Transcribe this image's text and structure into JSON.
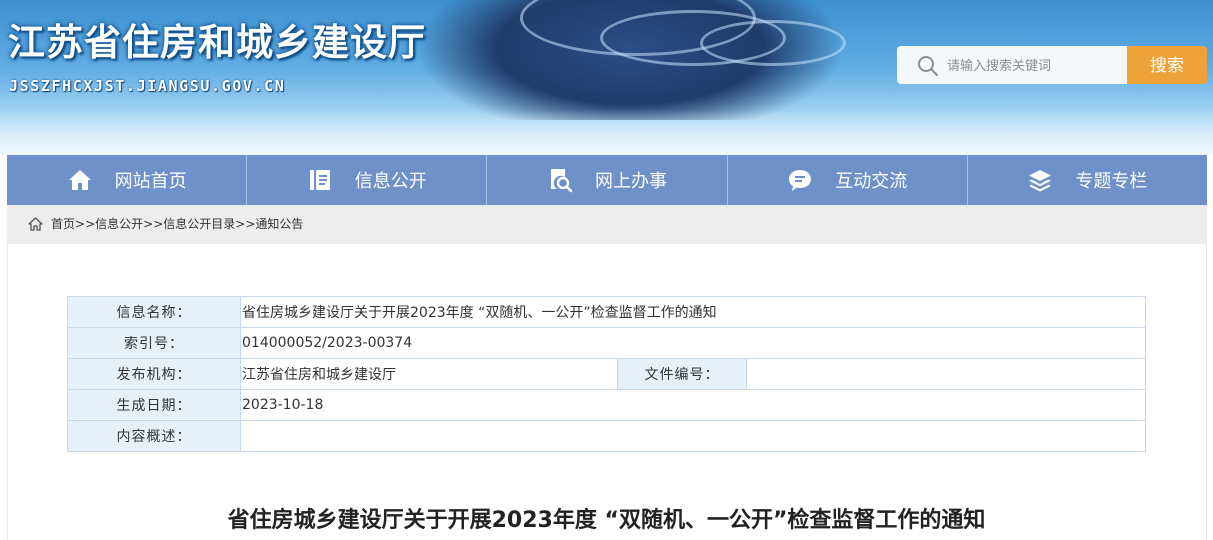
{
  "header": {
    "site_title": "江苏省住房和城乡建设厅",
    "site_domain": "JSSZFHCXJST.JIANGSU.GOV.CN",
    "search_placeholder": "请输入搜索关键词",
    "search_button": "搜索",
    "accent_color": "#f0a23a"
  },
  "nav": {
    "background": "#6e91c9",
    "items": [
      {
        "label": "网站首页",
        "icon": "home-icon"
      },
      {
        "label": "信息公开",
        "icon": "document-icon"
      },
      {
        "label": "网上办事",
        "icon": "search-document-icon"
      },
      {
        "label": "互动交流",
        "icon": "chat-icon"
      },
      {
        "label": "专题专栏",
        "icon": "layers-icon"
      }
    ]
  },
  "breadcrumb": {
    "items": [
      "首页",
      "信息公开",
      "信息公开目录",
      "通知公告"
    ],
    "separator": ">>"
  },
  "info": {
    "name_label": "信息名称：",
    "name_value": "省住房城乡建设厅关于开展2023年度 “双随机、一公开”检查监督工作的通知",
    "index_label": "索引号：",
    "index_value": "014000052/2023-00374",
    "org_label": "发布机构：",
    "org_value": "江苏省住房和城乡建设厅",
    "docno_label": "文件编号：",
    "docno_value": "",
    "date_label": "生成日期：",
    "date_value": "2023-10-18",
    "summary_label": "内容概述：",
    "summary_value": ""
  },
  "article": {
    "title": "省住房城乡建设厅关于开展2023年度 “双随机、一公开”检查监督工作的通知"
  }
}
